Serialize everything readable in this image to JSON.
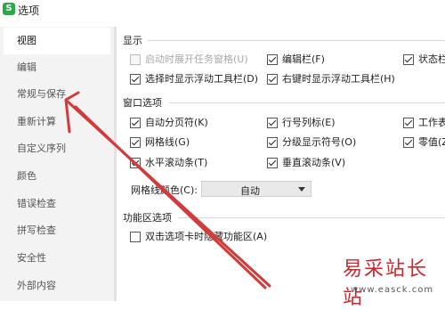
{
  "window": {
    "title": "选项",
    "logo_letter": "S"
  },
  "sidebar": {
    "items": [
      {
        "label": "视图",
        "selected": true
      },
      {
        "label": "编辑"
      },
      {
        "label": "常规与保存"
      },
      {
        "label": "重新计算"
      },
      {
        "label": "自定义序列"
      },
      {
        "label": "颜色"
      },
      {
        "label": "错误检查"
      },
      {
        "label": "拼写检查"
      },
      {
        "label": "安全性"
      },
      {
        "label": "外部内容"
      }
    ]
  },
  "display": {
    "title": "显示",
    "options": [
      {
        "label": "启动时展开任务窗格(U)",
        "checked": false,
        "disabled": true
      },
      {
        "label": "编辑栏(F)",
        "checked": true
      },
      {
        "label": "状态栏",
        "checked": true
      },
      {
        "label": "选择时显示浮动工具栏(D)",
        "checked": true
      },
      {
        "label": "右键时显示浮动工具栏(H)",
        "checked": true
      }
    ]
  },
  "window_options": {
    "title": "窗口选项",
    "options": [
      {
        "label": "自动分页符(K)",
        "checked": true
      },
      {
        "label": "行号列标(E)",
        "checked": true
      },
      {
        "label": "工作表",
        "checked": true
      },
      {
        "label": "网格线(G)",
        "checked": true
      },
      {
        "label": "分级显示符号(O)",
        "checked": true
      },
      {
        "label": "零值(Z",
        "checked": true
      },
      {
        "label": "水平滚动条(T)",
        "checked": true
      },
      {
        "label": "垂直滚动条(V)",
        "checked": true
      }
    ],
    "grid_color_label": "网格线颜色(C):",
    "grid_color_value": "自动"
  },
  "ribbon": {
    "title": "功能区选项",
    "options": [
      {
        "label": "双击选项卡时隐藏功能区(A)",
        "checked": false
      }
    ]
  },
  "watermark": {
    "title": "易采站长站",
    "url": "www.easck.com"
  },
  "colors": {
    "annotation_arrow": "#d33a3a",
    "logo": "#2aa84a",
    "watermark": "#c8282d"
  }
}
